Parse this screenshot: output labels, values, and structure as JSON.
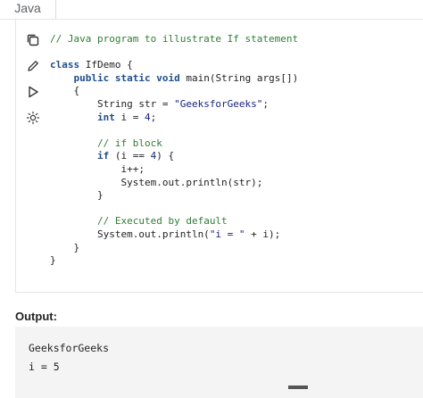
{
  "tabs": [
    {
      "label": "Java",
      "active": true
    }
  ],
  "toolbar": {
    "icons": [
      "copy-icon",
      "edit-icon",
      "run-icon",
      "theme-icon"
    ]
  },
  "code": {
    "language": "Java",
    "lines": [
      "// Java program to illustrate If statement",
      "",
      "class IfDemo {",
      "    public static void main(String args[])",
      "    {",
      "        String str = \"GeeksforGeeks\";",
      "        int i = 4;",
      "",
      "        // if block",
      "        if (i == 4) {",
      "            i++;",
      "            System.out.println(str);",
      "        }",
      "",
      "        // Executed by default",
      "        System.out.println(\"i = \" + i);",
      "    }",
      "}"
    ]
  },
  "output": {
    "title": "Output:",
    "lines": [
      "GeeksforGeeks",
      "i = 5"
    ]
  },
  "colors": {
    "keyword": "#1e4e8c",
    "comment": "#2e7d32",
    "string": "#1a237e",
    "output_bg": "#f4f4f4"
  }
}
